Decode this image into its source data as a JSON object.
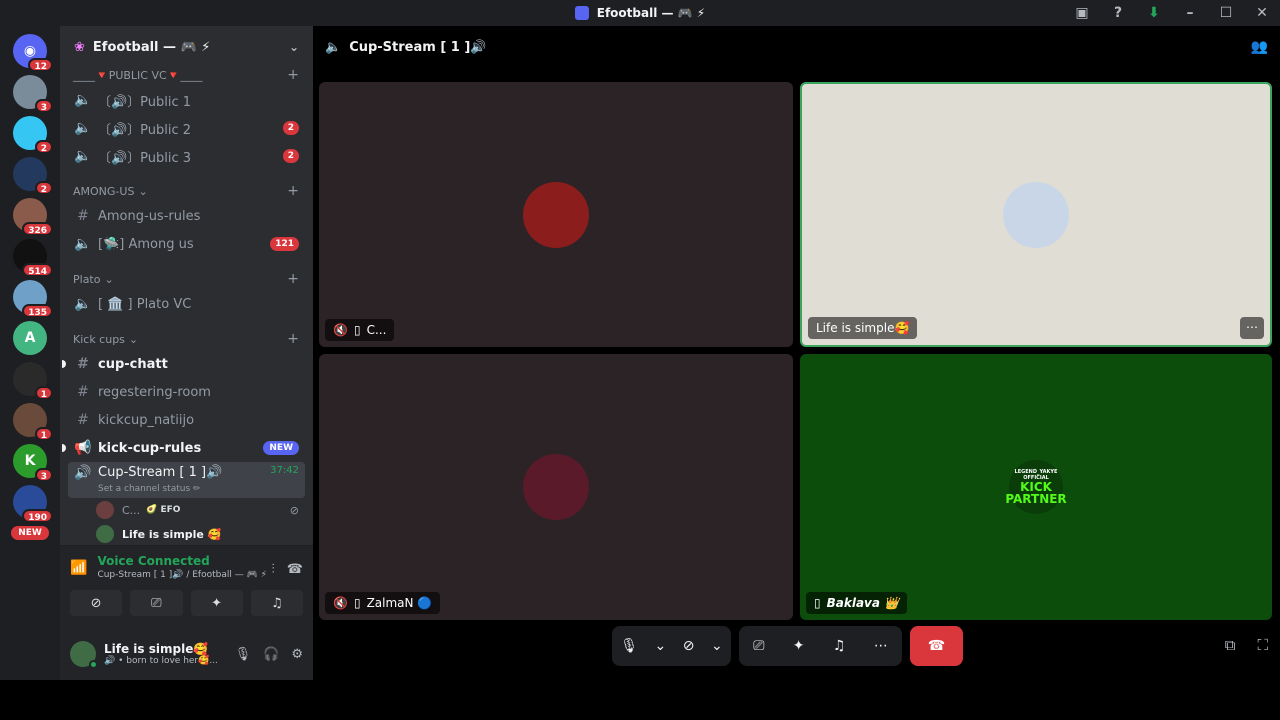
{
  "window": {
    "title": "Efootball — 🎮 ⚡"
  },
  "guilds": [
    {
      "initial": "",
      "color": "#5865f2",
      "badge": "12"
    },
    {
      "initial": "",
      "color": "#7a8b9a",
      "badge": "3"
    },
    {
      "initial": "",
      "color": "#35c6f4",
      "badge": "2"
    },
    {
      "initial": "",
      "color": "#233a5e",
      "badge": "2"
    },
    {
      "initial": "",
      "color": "#8a5a4a",
      "badge": "326"
    },
    {
      "initial": "",
      "color": "#111111",
      "badge": "514"
    },
    {
      "initial": "",
      "color": "#6fa0c8",
      "badge": "135"
    },
    {
      "initial": "A",
      "color": "#43b581",
      "badge": ""
    },
    {
      "initial": "",
      "color": "#2a2a2a",
      "badge": "1"
    },
    {
      "initial": "",
      "color": "#6a4a3a",
      "badge": "1"
    },
    {
      "initial": "K",
      "color": "#2b9b2b",
      "badge": "3"
    },
    {
      "initial": "",
      "color": "#2a4a9a",
      "badge": "190"
    }
  ],
  "guild_new_label": "NEW",
  "server": {
    "name": "Efootball — 🎮 ⚡"
  },
  "categories": {
    "public_vc": "____🔻PUBLIC VC🔻____",
    "among_us": "AMONG-US",
    "plato": "Plato",
    "kick_cups": "Kick cups"
  },
  "channels": {
    "public1": {
      "label": "〔🔊〕Public 1",
      "count": ""
    },
    "public2": {
      "label": "〔🔊〕Public 2",
      "count": "2"
    },
    "public3": {
      "label": "〔🔊〕Public 3",
      "count": "2"
    },
    "among_rules": {
      "label": "Among-us-rules"
    },
    "among_us": {
      "label": "[🛸] Among us",
      "count": "121"
    },
    "plato_vc": {
      "label": "[ 🏛️ ] Plato VC"
    },
    "cup_chatt": {
      "label": "cup-chatt"
    },
    "registering": {
      "label": "regestering-room"
    },
    "kickcup": {
      "label": "kickcup_natiijo"
    },
    "kick_rules": {
      "label": "kick-cup-rules",
      "tag": "NEW"
    },
    "cup_stream": {
      "label": "Cup-Stream [ 1 ]🔊",
      "time": "37:42",
      "status": "Set a channel status ✏"
    }
  },
  "voice_users": [
    {
      "name": "C...",
      "tag": "🥑 EFO"
    },
    {
      "name": "Life is simple 🥰",
      "tag": ""
    }
  ],
  "voice_panel": {
    "title": "Voice Connected",
    "subtitle": "Cup-Stream [ 1 ]🔊 / Efootball — 🎮 ⚡"
  },
  "user": {
    "name": "Life is simple🥰",
    "status": "🔊 • born to love her🥰..."
  },
  "main": {
    "channel_title": "Cup-Stream [ 1 ]🔊",
    "tiles": [
      {
        "label": "C...",
        "bg": "#2b2325",
        "avatar": "#8b1d1d"
      },
      {
        "label": "Life is simple🥰",
        "bg": "#e0ddd4",
        "avatar": "#c9d6e8"
      },
      {
        "label": "ZalmaN 🔵",
        "bg": "#2b2326",
        "avatar": "#5a1a2a"
      },
      {
        "label": "Baklava 👑",
        "bg": "#0c4d0c",
        "avatar": ""
      }
    ],
    "kick_top": "LEGEND_YAKYE",
    "kick_official": "OFFICIAL",
    "kick_main1": "KICK",
    "kick_main2": "PARTNER"
  },
  "colors": {
    "accent": "#5865f2",
    "danger": "#da373c",
    "online": "#23a55a",
    "speaking_border": "#3ba55d"
  }
}
